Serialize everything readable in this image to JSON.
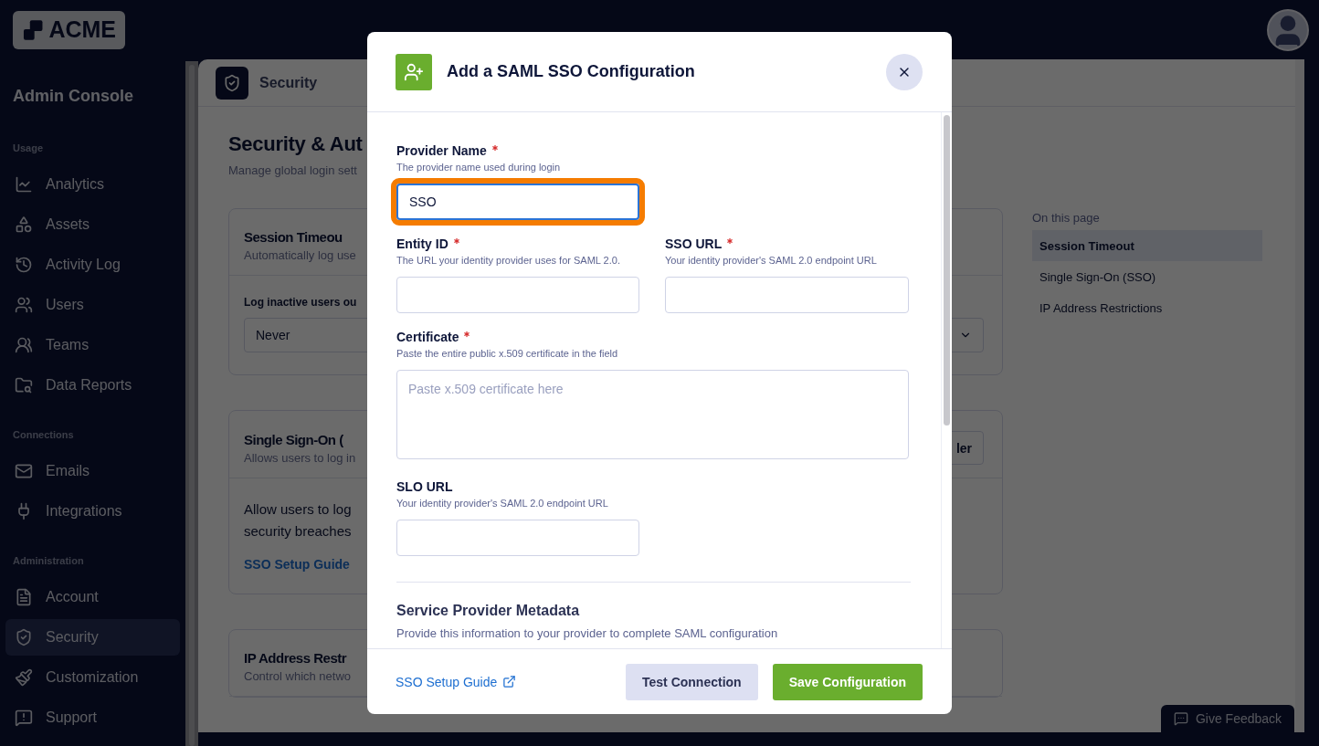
{
  "topbar": {
    "logo": "ACME"
  },
  "sidebar": {
    "title": "Admin Console",
    "sections": [
      {
        "heading": "Usage",
        "items": [
          {
            "label": "Analytics",
            "selected": false
          },
          {
            "label": "Assets",
            "selected": false
          },
          {
            "label": "Activity Log",
            "selected": false
          },
          {
            "label": "Users",
            "selected": false
          },
          {
            "label": "Teams",
            "selected": false
          },
          {
            "label": "Data Reports",
            "selected": false
          }
        ]
      },
      {
        "heading": "Connections",
        "items": [
          {
            "label": "Emails",
            "selected": false
          },
          {
            "label": "Integrations",
            "selected": false
          }
        ]
      },
      {
        "heading": "Administration",
        "items": [
          {
            "label": "Account",
            "selected": false
          },
          {
            "label": "Security",
            "selected": true
          },
          {
            "label": "Customization",
            "selected": false
          },
          {
            "label": "Support",
            "selected": false
          }
        ]
      }
    ]
  },
  "page": {
    "breadcrumb": "Security",
    "title": "Security & Aut",
    "subtitle": "Manage global login sett",
    "cards": [
      {
        "title": "Session Timeou",
        "subtitle": "Automatically log use",
        "field_label": "Log inactive users ou",
        "select_value": "Never"
      },
      {
        "title": "Single Sign-On (",
        "subtitle": "Allows users to log in",
        "button": "ler",
        "body_lines": [
          "Allow users to log",
          "security breaches"
        ],
        "link": "SSO Setup Guide"
      },
      {
        "title": "IP Address Restr",
        "subtitle": "Control which netwo"
      }
    ]
  },
  "toc": {
    "heading": "On this page",
    "items": [
      {
        "label": "Session Timeout",
        "selected": true
      },
      {
        "label": "Single Sign-On (SSO)",
        "selected": false
      },
      {
        "label": "IP Address Restrictions",
        "selected": false
      }
    ]
  },
  "feedback_button": "Give Feedback",
  "modal": {
    "title": "Add a SAML SSO Configuration",
    "rows": [
      [
        {
          "kind": "input",
          "label": "Provider Name",
          "required": true,
          "hint": "The provider name used during login",
          "value": "SSO",
          "focused": true,
          "highlighted": true
        }
      ],
      [
        {
          "kind": "input",
          "label": "Entity ID",
          "required": true,
          "hint": "The URL your identity provider uses for SAML 2.0.",
          "focused": false,
          "highlighted": false
        },
        {
          "kind": "input",
          "label": "SSO URL",
          "required": true,
          "hint": "Your identity provider's SAML 2.0 endpoint URL",
          "focused": false,
          "highlighted": false
        }
      ],
      [
        {
          "kind": "textarea",
          "label": "Certificate",
          "required": true,
          "hint": "Paste the entire public x.509 certificate in the field",
          "placeholder": "Paste x.509 certificate here",
          "focused": false,
          "highlighted": false
        }
      ],
      [
        {
          "kind": "input",
          "label": "SLO URL",
          "required": false,
          "hint": "Your identity provider's SAML 2.0 endpoint URL",
          "focused": false,
          "highlighted": false
        }
      ]
    ],
    "metadata": {
      "title": "Service Provider Metadata",
      "description": "Provide this information to your provider to complete SAML configuration"
    },
    "footer": {
      "link": "SSO Setup Guide",
      "buttons": [
        {
          "label": "Test Connection",
          "kind": "secondary"
        },
        {
          "label": "Save Configuration",
          "kind": "primary"
        }
      ]
    }
  }
}
